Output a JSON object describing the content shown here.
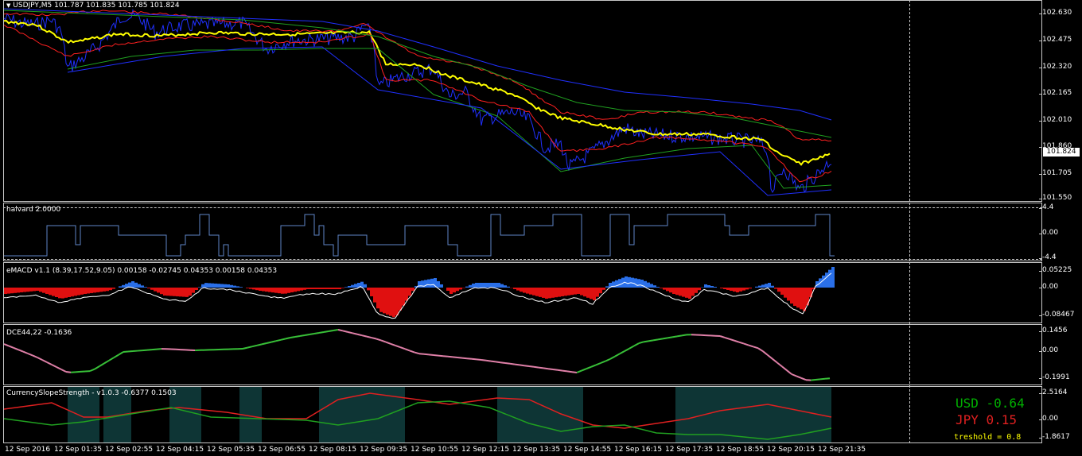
{
  "main_panel": {
    "title": "USDJPY,M5  101.787 101.835 101.785 101.824",
    "y_ticks": [
      "102.630",
      "102.475",
      "102.320",
      "102.165",
      "102.010",
      "101.860",
      "101.705",
      "101.550"
    ],
    "current_price": "101.824"
  },
  "halvard_panel": {
    "title": "halvard 2.0000",
    "y_ticks": [
      "4.4",
      "0.00",
      "-4.4"
    ]
  },
  "emacd_panel": {
    "title": "eMACD v1.1 (8.39,17.52,9.05) 0.00158 -0.02745 0.04353 0.00158 0.04353",
    "y_ticks": [
      "0.05225",
      "0.00",
      "-0.08467"
    ]
  },
  "dce_panel": {
    "title": "DCE44,22 -0.1636",
    "y_ticks": [
      "0.1456",
      "0.00",
      "-0.1991"
    ]
  },
  "css_panel": {
    "title": "CurrencySlopeStrength - v1.0.3 -0.6377 0.1503",
    "y_ticks": [
      "2.5164",
      "0.00",
      "-1.8617"
    ],
    "usd_label": "USD -0.64",
    "jpy_label": "JPY  0.15",
    "threshold_label": "treshold = 0.8"
  },
  "x_axis": {
    "labels": [
      "12 Sep 2016",
      "12 Sep 01:35",
      "12 Sep 02:55",
      "12 Sep 04:15",
      "12 Sep 05:35",
      "12 Sep 06:55",
      "12 Sep 08:15",
      "12 Sep 09:35",
      "12 Sep 10:55",
      "12 Sep 12:15",
      "12 Sep 13:35",
      "12 Sep 14:55",
      "12 Sep 16:15",
      "12 Sep 17:35",
      "12 Sep 18:55",
      "12 Sep 20:15",
      "12 Sep 21:35"
    ]
  },
  "colors": {
    "price": "#2030ff",
    "ma_fast": "#ffff00",
    "ma_red": "#ff2020",
    "ma_green": "#20a020",
    "ma_blue": "#2030ff",
    "halvard": "#5f86c8",
    "emacd_pos": "#2a6fe8",
    "emacd_neg": "#e01010",
    "dce_up": "#38c038",
    "dce_down": "#e080a8",
    "css_usd": "#20a020",
    "css_jpy": "#e02020",
    "css_zone": "#0e3535",
    "usd_text": "#00b000",
    "jpy_text": "#e02020",
    "threshold_text": "#ffff00"
  },
  "icons": {
    "menu": "triangle-down-icon"
  }
}
